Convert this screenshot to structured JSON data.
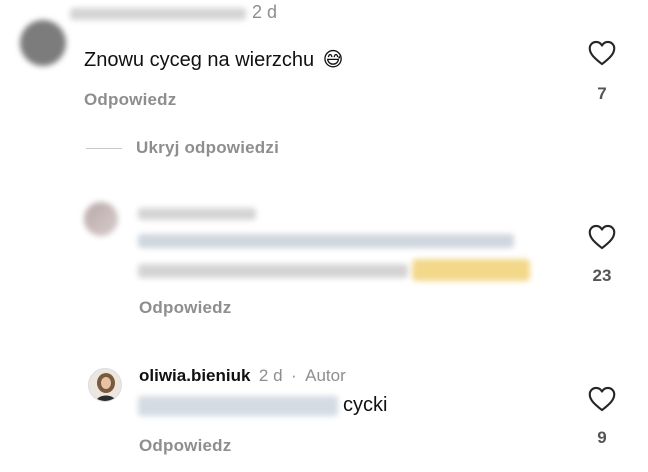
{
  "comments": [
    {
      "time": "2 d",
      "text": "Znowu cyceg na wierzchu",
      "emoji": "😅",
      "reply_label": "Odpowiedz",
      "likes": "7"
    }
  ],
  "hide_replies_label": "Ukryj odpowiedzi",
  "replies": [
    {
      "reply_label": "Odpowiedz",
      "likes": "23"
    },
    {
      "username": "oliwia.bieniuk",
      "time": "2 d",
      "separator": "·",
      "author_badge": "Autor",
      "visible_text": "cycki",
      "reply_label": "Odpowiedz",
      "likes": "9"
    }
  ],
  "icons": {
    "like": "heart-outline-icon"
  }
}
